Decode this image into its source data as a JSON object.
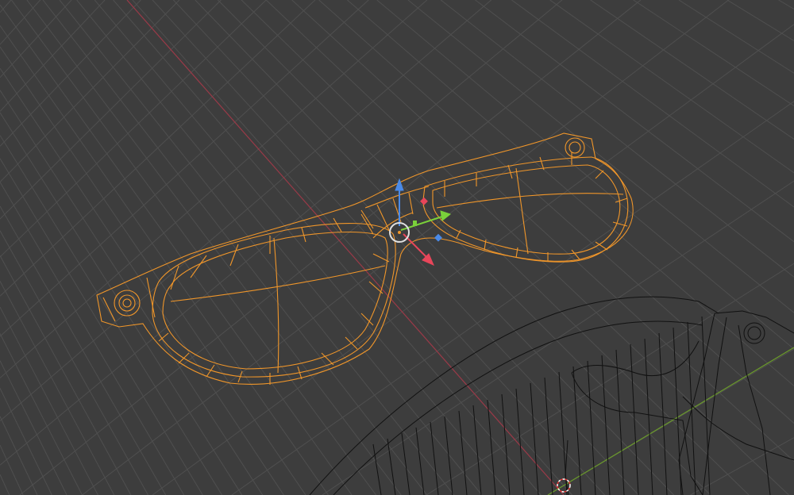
{
  "viewport": {
    "background": "#3d3d3d",
    "grid_color": "#4f4f4f",
    "x_axis_color": "#9a3a48",
    "y_axis_color": "#6a9a2a",
    "selected_color": "#f0962a",
    "wire_color": "#111111"
  },
  "gizmo": {
    "x_color": "#e8465a",
    "y_color": "#7ad03a",
    "z_color": "#4a8ae8",
    "pivot_color": "#e0e0e0"
  }
}
